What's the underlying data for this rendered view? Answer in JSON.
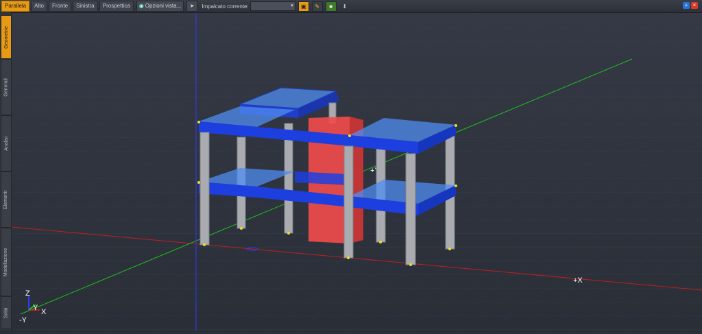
{
  "toolbar": {
    "view_tabs": [
      "Parallela",
      "Alto",
      "Fronte",
      "Sinistra",
      "Prospettica"
    ],
    "view_options": "Opzioni vista...",
    "floor_label": "Impalcato corrente:",
    "floor_value": ""
  },
  "sidebar": {
    "tabs": [
      "Geometrie",
      "Generali",
      "Analisi",
      "Elementi",
      "Modellazione",
      "Solai"
    ]
  },
  "viewport": {
    "axis_labels": {
      "plus_x": "+X",
      "plus_y": "+Y"
    },
    "gizmo": {
      "z": "Z",
      "y": "Y",
      "x": "X",
      "minus_y": "-Y"
    }
  },
  "colors": {
    "accent": "#e89a14",
    "background": "#2b2f38",
    "x_axis": "#c02020",
    "y_axis": "#1fbf1f",
    "z_axis": "#2a3cff",
    "beam": "#1d3fe0",
    "slab": "#4f8cf0",
    "column": "#a9abb0",
    "core_wall": "#ef4b4b"
  }
}
